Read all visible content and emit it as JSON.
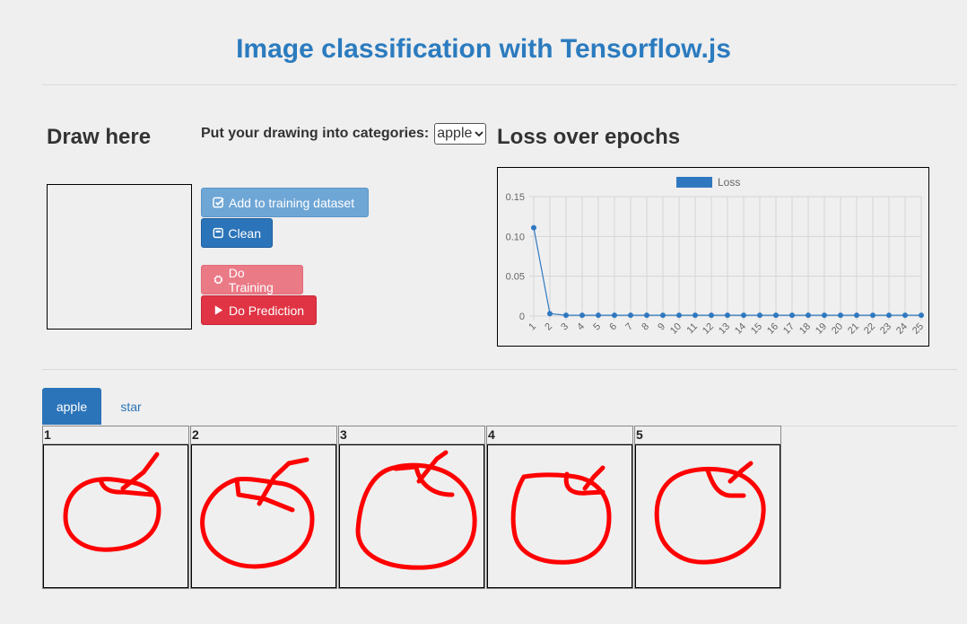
{
  "page": {
    "title": "Image classification with Tensorflow.js"
  },
  "draw": {
    "heading": "Draw here"
  },
  "categories": {
    "label": "Put your drawing into categories:",
    "selected": "apple"
  },
  "buttons": {
    "add": "Add to training dataset",
    "clean": "Clean",
    "train": "Do Training",
    "predict": "Do Prediction"
  },
  "loss": {
    "heading": "Loss over epochs"
  },
  "chart_data": {
    "type": "line",
    "series": [
      {
        "name": "Loss",
        "color": "#2f78c0",
        "values": [
          0.111,
          0.003,
          0.001,
          0.001,
          0.001,
          0.001,
          0.001,
          0.001,
          0.001,
          0.001,
          0.001,
          0.001,
          0.001,
          0.001,
          0.001,
          0.001,
          0.001,
          0.001,
          0.001,
          0.001,
          0.001,
          0.001,
          0.001,
          0.001,
          0.001
        ]
      }
    ],
    "x": [
      1,
      2,
      3,
      4,
      5,
      6,
      7,
      8,
      9,
      10,
      11,
      12,
      13,
      14,
      15,
      16,
      17,
      18,
      19,
      20,
      21,
      22,
      23,
      24,
      25
    ],
    "ylim": [
      0,
      0.15
    ],
    "yticks": [
      "0.15",
      "0.10",
      "0.05",
      "0"
    ],
    "grid": true,
    "legend": "top-center"
  },
  "tabs": [
    {
      "label": "apple",
      "active": true
    },
    {
      "label": "star",
      "active": false
    }
  ],
  "gallery": {
    "items": [
      {
        "num": "1"
      },
      {
        "num": "2"
      },
      {
        "num": "3"
      },
      {
        "num": "4"
      },
      {
        "num": "5"
      }
    ]
  },
  "colors": {
    "accent": "#2b74b9",
    "title": "#2b7bbf",
    "danger": "#e03444",
    "drawing": "#ff0000"
  }
}
